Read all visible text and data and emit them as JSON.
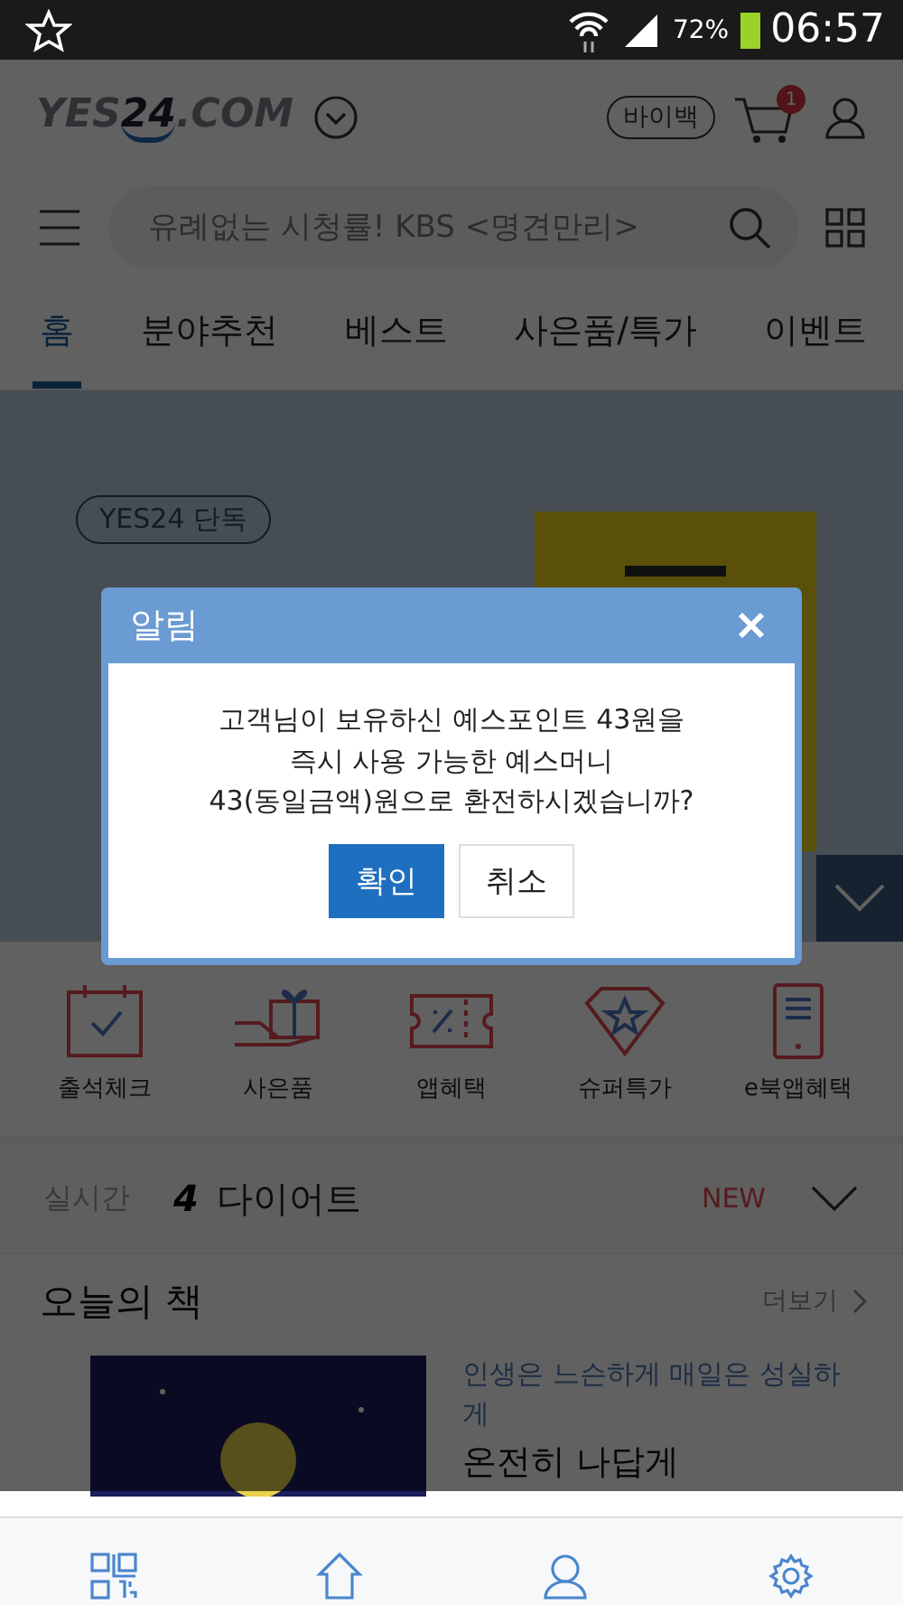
{
  "status_bar": {
    "battery": "72%",
    "time": "06:57"
  },
  "header": {
    "logo_left": "YES",
    "logo_number": "24",
    "logo_right": ".COM",
    "buyback": "바이백",
    "cart_badge": "1"
  },
  "search": {
    "placeholder": "유례없는 시청률! KBS <명견만리>"
  },
  "tabs": [
    {
      "label": "홈",
      "selected": true
    },
    {
      "label": "분야추천",
      "selected": false
    },
    {
      "label": "베스트",
      "selected": false
    },
    {
      "label": "사은품/특가",
      "selected": false
    },
    {
      "label": "이벤트",
      "selected": false
    }
  ],
  "banner": {
    "tag": "YES24 단독"
  },
  "quick_menu": [
    {
      "label": "출석체크"
    },
    {
      "label": "사은품"
    },
    {
      "label": "앱혜택"
    },
    {
      "label": "슈퍼특가"
    },
    {
      "label": "e북앱혜택"
    }
  ],
  "realtime": {
    "label": "실시간",
    "rank": "4",
    "keyword": "다이어트",
    "badge": "NEW"
  },
  "today_book": {
    "title": "오늘의 책",
    "more": "더보기",
    "subtitle": "인생은 느슨하게 매일은 성실하게",
    "book_title": "온전히 나답게"
  },
  "dialog": {
    "title": "알림",
    "message": [
      "고객님이 보유하신 예스포인트 43원을",
      "즉시 사용 가능한 예스머니",
      "43(동일금액)원으로 환전하시겠습니까?"
    ],
    "buttons": [
      {
        "label": "확인",
        "kind": "primary"
      },
      {
        "label": "취소",
        "kind": "secondary"
      }
    ]
  }
}
